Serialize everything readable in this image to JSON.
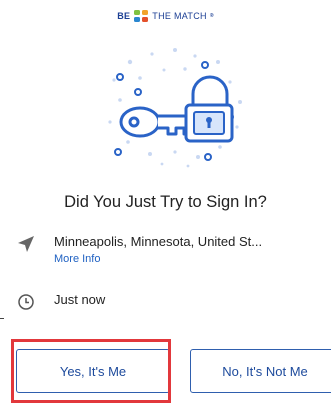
{
  "logo": {
    "part1": "BE",
    "part2": "THE MATCH",
    "trademark": "®",
    "mark_icon": "four-squares-logo",
    "brand_color": "#1c3f94"
  },
  "illustration": {
    "icon": "key-and-padlock-icon",
    "color": "#2a63c7"
  },
  "title": "Did You Just Try to Sign In?",
  "location": {
    "icon": "location-arrow-icon",
    "text": "Minneapolis, Minnesota, United St...",
    "link": "More Info"
  },
  "time": {
    "icon": "clock-icon",
    "text": "Just now"
  },
  "buttons": {
    "yes": "Yes, It's Me",
    "no": "No, It's Not Me"
  },
  "colors": {
    "accent": "#2f5fae",
    "link": "#1f61c2",
    "highlight": "#e2383c"
  }
}
